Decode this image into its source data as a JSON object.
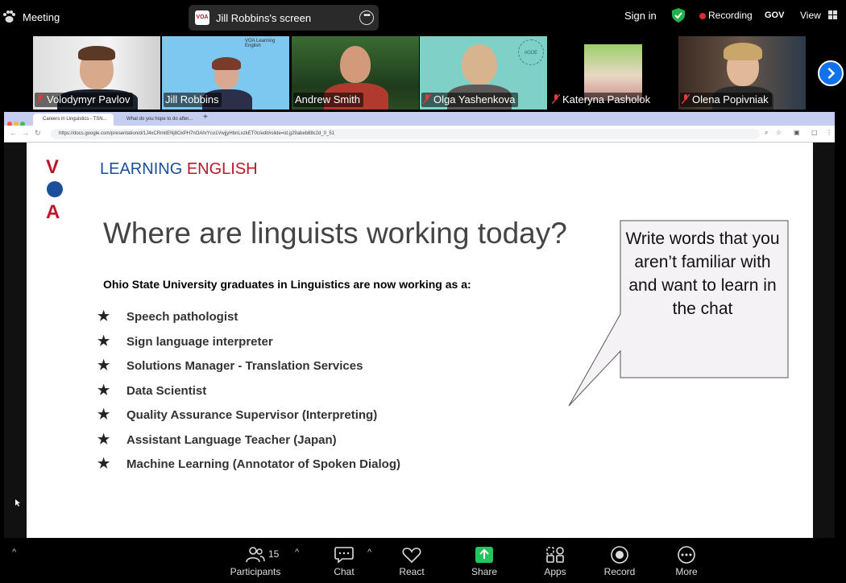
{
  "topbar": {
    "title": "Meeting",
    "screen_label": "Jill Robbins's screen",
    "sign_in": "Sign in",
    "recording": "Recording",
    "gov": "GOV",
    "view": "View"
  },
  "participants": [
    {
      "name": "Volodymyr Pavlov",
      "muted": true
    },
    {
      "name": "Jill Robbins",
      "muted": false,
      "active": true
    },
    {
      "name": "Andrew Smith",
      "muted": false
    },
    {
      "name": "Olga Yashenkova",
      "muted": true
    },
    {
      "name": "Kateryna Pasholok",
      "muted": true
    },
    {
      "name": "Olena Popivniak",
      "muted": true
    }
  ],
  "browser": {
    "tab1": "Careers in Linguistics - TSN...",
    "tab2": "What do you hope to do after...",
    "url": "https://docs.google.com/presentation/d/1J4xCRmitENj8OxPH7nOAhrYco1VwjjyHbnLxzkET0c/edit#slide=id.g29abeb88c2d_0_51"
  },
  "slide": {
    "logo_mark": "VOA",
    "logo_text_1": "LEARNING",
    "logo_text_2": "ENGLISH",
    "title": "Where are linguists working today?",
    "subtitle": "Ohio State University graduates in Linguistics are now working as a:",
    "items": [
      "Speech pathologist",
      "Sign language interpreter",
      "Solutions Manager - Translation Services",
      "Data Scientist",
      "Quality Assurance Supervisor (Interpreting)",
      "Assistant Language Teacher (Japan)",
      "Machine Learning (Annotator of Spoken Dialog)"
    ],
    "callout": "Write words that you aren’t familiar with and want to learn in the chat"
  },
  "toolbar": {
    "participants": "Participants",
    "participants_count": "15",
    "chat": "Chat",
    "react": "React",
    "share": "Share",
    "apps": "Apps",
    "record": "Record",
    "more": "More"
  },
  "colors": {
    "share_green": "#22c55e",
    "active_border": "#2bd65a",
    "voa_red": "#b8192c",
    "voa_blue": "#1b4f9c"
  }
}
